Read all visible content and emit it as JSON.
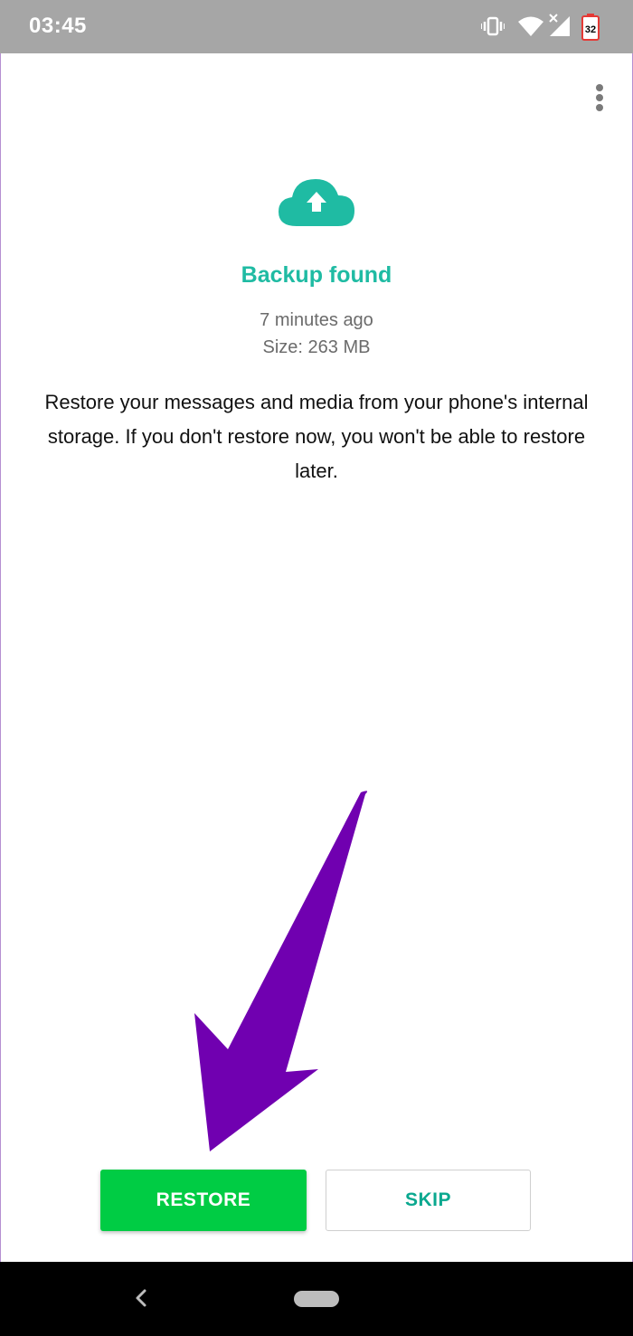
{
  "status_bar": {
    "time": "03:45",
    "battery_level": "32",
    "icons": [
      "vibrate-icon",
      "wifi-icon",
      "signal-icon",
      "battery-icon"
    ]
  },
  "header": {
    "menu_icon": "more-vert-icon"
  },
  "backup": {
    "icon": "cloud-upload-icon",
    "title": "Backup found",
    "time_ago": "7 minutes ago",
    "size": "Size: 263 MB",
    "description": "Restore your messages and media from your phone's internal storage. If you don't restore now, you won't be able to restore later."
  },
  "actions": {
    "restore_label": "RESTORE",
    "skip_label": "SKIP"
  },
  "nav_bar": {
    "icons": [
      "back-icon",
      "home-pill-icon"
    ]
  },
  "colors": {
    "accent": "#1fbba3",
    "restore_button": "#00cc44",
    "skip_text": "#0aa88f",
    "status_bar": "#a6a6a6",
    "annotation_arrow": "#7000b0"
  }
}
